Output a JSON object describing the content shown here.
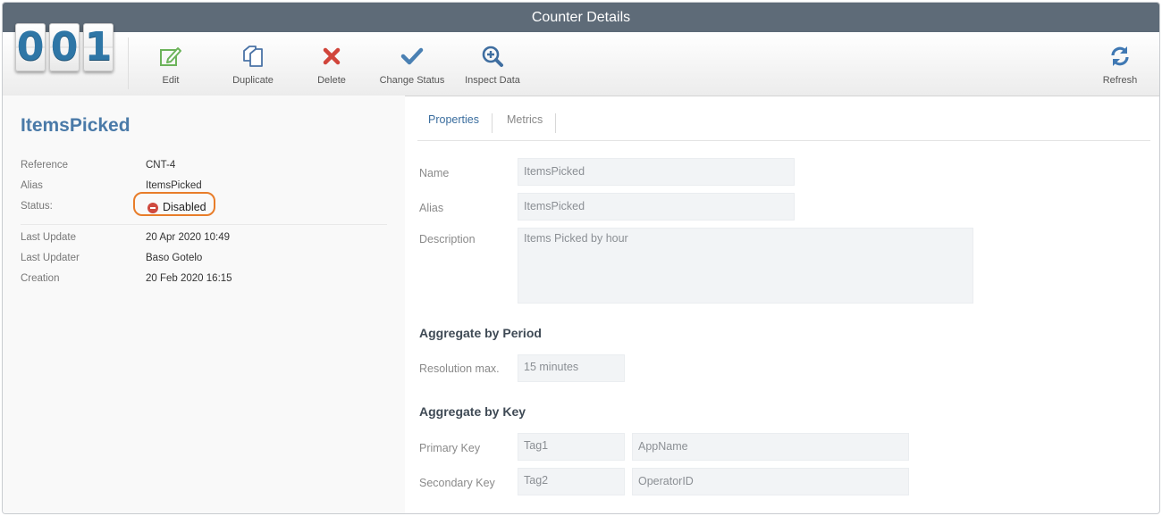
{
  "window": {
    "title": "Counter Details"
  },
  "counter": {
    "digits": [
      "0",
      "0",
      "1"
    ]
  },
  "toolbar": {
    "edit": "Edit",
    "duplicate": "Duplicate",
    "delete": "Delete",
    "change_status": "Change Status",
    "inspect_data": "Inspect Data",
    "refresh": "Refresh"
  },
  "icons": {
    "edit": "edit-icon",
    "duplicate": "duplicate-icon",
    "delete": "delete-icon",
    "change_status": "checkmark-icon",
    "inspect_data": "inspect-data-icon",
    "refresh": "refresh-icon",
    "status": "disabled-status-icon"
  },
  "colors": {
    "titlebar": "#5e6b78",
    "title_text": "#4a7aa8",
    "edit_icon": "#6cb35a",
    "duplicate_icon": "#4a73a6",
    "delete_icon": "#d1453b",
    "check_icon": "#4a80b3",
    "status_highlight": "#e87d2a"
  },
  "summary": {
    "title": "ItemsPicked",
    "reference_label": "Reference",
    "reference_value": "CNT-4",
    "alias_label": "Alias",
    "alias_value": "ItemsPicked",
    "status_label": "Status:",
    "status_value": "Disabled",
    "last_update_label": "Last Update",
    "last_update_value": "20 Apr 2020 10:49",
    "last_updater_label": "Last Updater",
    "last_updater_value": "Baso Gotelo",
    "creation_label": "Creation",
    "creation_value": "20 Feb 2020 16:15"
  },
  "tabs": {
    "properties": "Properties",
    "metrics": "Metrics",
    "active": "Properties"
  },
  "properties": {
    "name_label": "Name",
    "name_value": "ItemsPicked",
    "alias_label": "Alias",
    "alias_value": "ItemsPicked",
    "description_label": "Description",
    "description_value": "Items Picked by hour",
    "aggregate_period_heading": "Aggregate by Period",
    "resolution_label": "Resolution max.",
    "resolution_value": "15 minutes",
    "aggregate_key_heading": "Aggregate by Key",
    "primary_key_label": "Primary Key",
    "primary_key_tag": "Tag1",
    "primary_key_value": "AppName",
    "secondary_key_label": "Secondary Key",
    "secondary_key_tag": "Tag2",
    "secondary_key_value": "OperatorID"
  }
}
